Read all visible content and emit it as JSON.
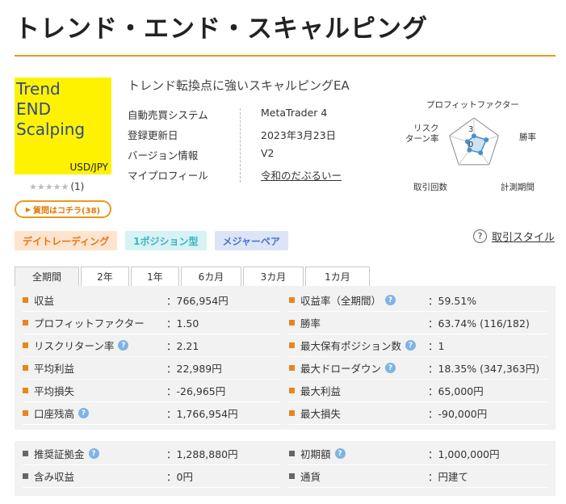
{
  "page_title": "トレンド・エンド・スキャルピング",
  "logo": {
    "line1": "Trend",
    "line2": "END",
    "line3": "Scalping",
    "pair": "USD/JPY"
  },
  "rating": {
    "stars": "★★★★★",
    "count": "(1)"
  },
  "question_button": "質問はコチラ(38)",
  "subtitle": "トレンド転換点に強いスキャルピングEA",
  "info": [
    {
      "key": "自動売買システム",
      "value": "MetaTrader 4"
    },
    {
      "key": "登録更新日",
      "value": "2023年3月23日"
    },
    {
      "key": "バージョン情報",
      "value": "V2"
    },
    {
      "key": "マイプロフィール",
      "value": "令和のだぶるいー"
    }
  ],
  "radar": {
    "labels": {
      "pf": "プロフィットファクター",
      "win": "勝率",
      "period": "計測期間",
      "trades": "取引回数",
      "risk1": "リスク",
      "risk2": "ターン率"
    },
    "scale_max": "3",
    "scale_min": "0",
    "values": {
      "pf": 0.9,
      "win": 1.5,
      "period": 1.3,
      "trades": 0.9,
      "risk": 0.8
    },
    "colors": {
      "fill": "#cde3f5",
      "stroke": "#4a90c9"
    }
  },
  "tags": [
    "デイトレーディング",
    "1ポジション型",
    "メジャーペア"
  ],
  "style_link": {
    "icon": "?",
    "text": "取引スタイル"
  },
  "tabs": [
    "全期間",
    "2年",
    "1年",
    "6カ月",
    "3カ月",
    "1カ月"
  ],
  "stats": [
    {
      "label": "収益",
      "value": "：766,954円",
      "help": false
    },
    {
      "label": "収益率（全期間）",
      "value": "：59.51%",
      "help": true
    },
    {
      "label": "プロフィットファクター",
      "value": "：1.50",
      "help": false
    },
    {
      "label": "勝率",
      "value": "：63.74% (116/182)",
      "help": false
    },
    {
      "label": "リスクリターン率",
      "value": "：2.21",
      "help": true
    },
    {
      "label": "最大保有ポジション数",
      "value": "：1",
      "help": true
    },
    {
      "label": "平均利益",
      "value": "：22,989円",
      "help": false
    },
    {
      "label": "最大ドローダウン",
      "value": "：18.35% (347,363円)",
      "help": true
    },
    {
      "label": "平均損失",
      "value": "：-26,965円",
      "help": false
    },
    {
      "label": "最大利益",
      "value": "：65,000円",
      "help": false
    },
    {
      "label": "口座残高",
      "value": "：1,766,954円",
      "help": true
    },
    {
      "label": "最大損失",
      "value": "：-90,000円",
      "help": false
    }
  ],
  "stats2": [
    {
      "label": "推奨証拠金",
      "value": "：1,288,880円",
      "help": true
    },
    {
      "label": "初期額",
      "value": "：1,000,000円",
      "help": true
    },
    {
      "label": "含み収益",
      "value": "：0円",
      "help": false
    },
    {
      "label": "通貨",
      "value": "：円建て",
      "help": false
    }
  ],
  "help_icon": "?"
}
